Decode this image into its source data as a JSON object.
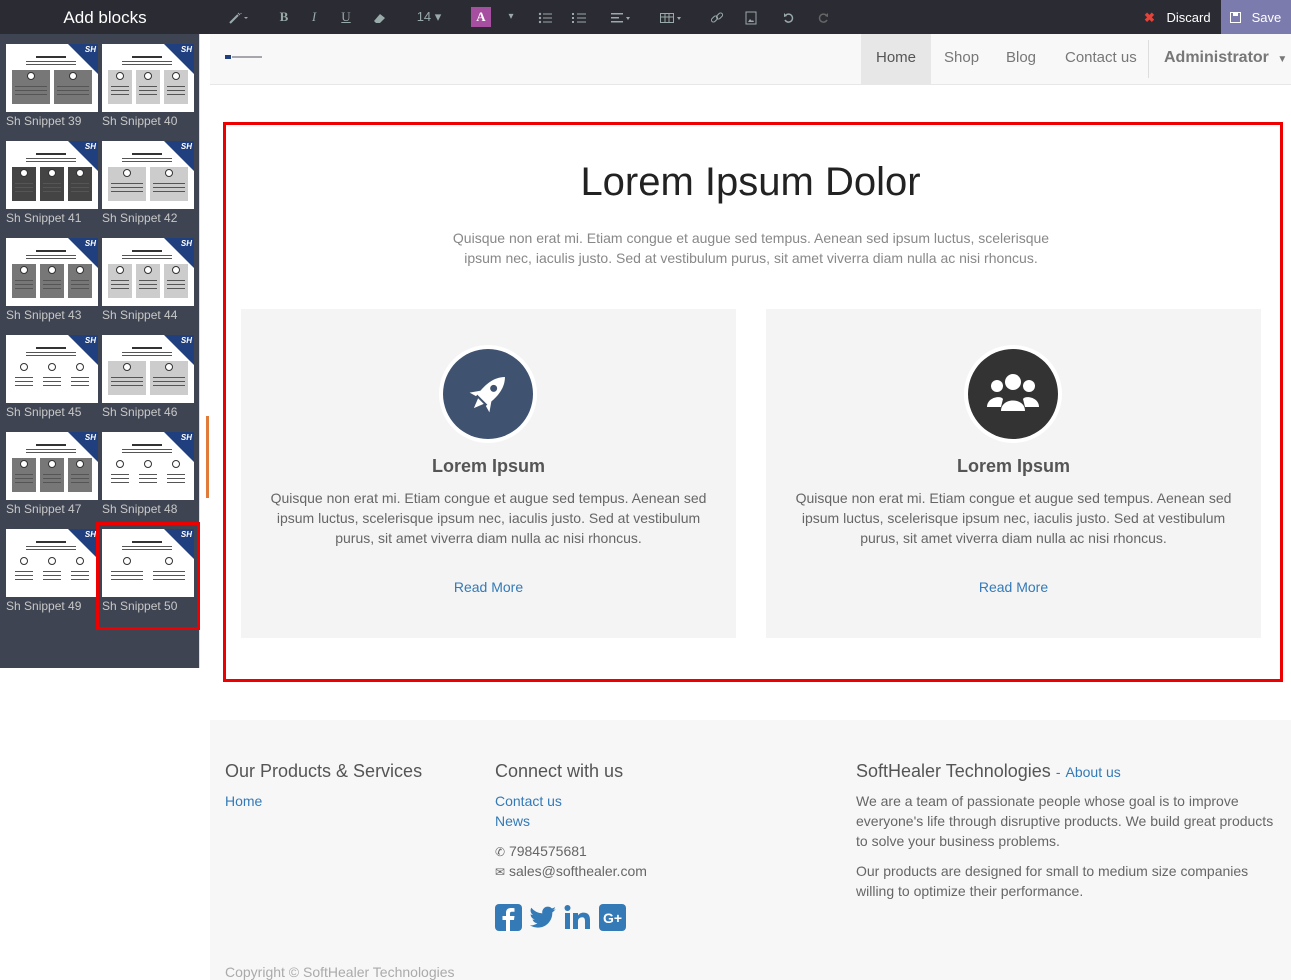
{
  "sidebar": {
    "title": "Add blocks",
    "snippets": [
      {
        "label": "Sh Snippet 39"
      },
      {
        "label": "Sh Snippet 40"
      },
      {
        "label": "Sh Snippet 41"
      },
      {
        "label": "Sh Snippet 42"
      },
      {
        "label": "Sh Snippet 43"
      },
      {
        "label": "Sh Snippet 44"
      },
      {
        "label": "Sh Snippet 45"
      },
      {
        "label": "Sh Snippet 46"
      },
      {
        "label": "Sh Snippet 47"
      },
      {
        "label": "Sh Snippet 48"
      },
      {
        "label": "Sh Snippet 49"
      },
      {
        "label": "Sh Snippet 50"
      }
    ],
    "badge": "SH",
    "selected": "Sh Snippet 50"
  },
  "toolbar": {
    "font_size": "14",
    "color_letter": "A",
    "discard_label": "Discard",
    "save_label": "Save"
  },
  "nav": {
    "items": [
      "Home",
      "Shop",
      "Blog",
      "Contact us"
    ],
    "active": "Home",
    "user": "Administrator"
  },
  "main": {
    "heading": "Lorem Ipsum Dolor",
    "subtext": "Quisque non erat mi. Etiam congue et augue sed tempus. Aenean sed ipsum luctus, scelerisque ipsum nec, iaculis justo. Sed at vestibulum purus, sit amet viverra diam nulla ac nisi rhoncus.",
    "cards": [
      {
        "icon": "rocket-icon",
        "color": "#3f5370",
        "title": "Lorem Ipsum",
        "text": "Quisque non erat mi. Etiam congue et augue sed tempus. Aenean sed ipsum luctus, scelerisque ipsum nec, iaculis justo. Sed at vestibulum purus, sit amet viverra diam nulla ac nisi rhoncus.",
        "link": "Read More"
      },
      {
        "icon": "users-icon",
        "color": "#333333",
        "title": "Lorem Ipsum",
        "text": "Quisque non erat mi. Etiam congue et augue sed tempus. Aenean sed ipsum luctus, scelerisque ipsum nec, iaculis justo. Sed at vestibulum purus, sit amet viverra diam nulla ac nisi rhoncus.",
        "link": "Read More"
      }
    ]
  },
  "footer": {
    "col1": {
      "title": "Our Products & Services",
      "links": [
        "Home"
      ]
    },
    "col2": {
      "title": "Connect with us",
      "links": [
        "Contact us",
        "News"
      ],
      "phone": "7984575681",
      "email": "sales@softhealer.com"
    },
    "col3": {
      "title": "SoftHealer Technologies",
      "sep": "-",
      "about": "About us",
      "p1": "We are a team of passionate people whose goal is to improve everyone's life through disruptive products. We build great products to solve your business problems.",
      "p2": "Our products are designed for small to medium size companies willing to optimize their performance."
    },
    "copyright": "Copyright © SoftHealer Technologies",
    "social_color": "#337ab7"
  },
  "colors": {
    "accent": "#337ab7",
    "highlight": "#e00000",
    "sidebar": "#3e4451",
    "toolbar": "#2b2b33",
    "save": "#7c7bad"
  }
}
